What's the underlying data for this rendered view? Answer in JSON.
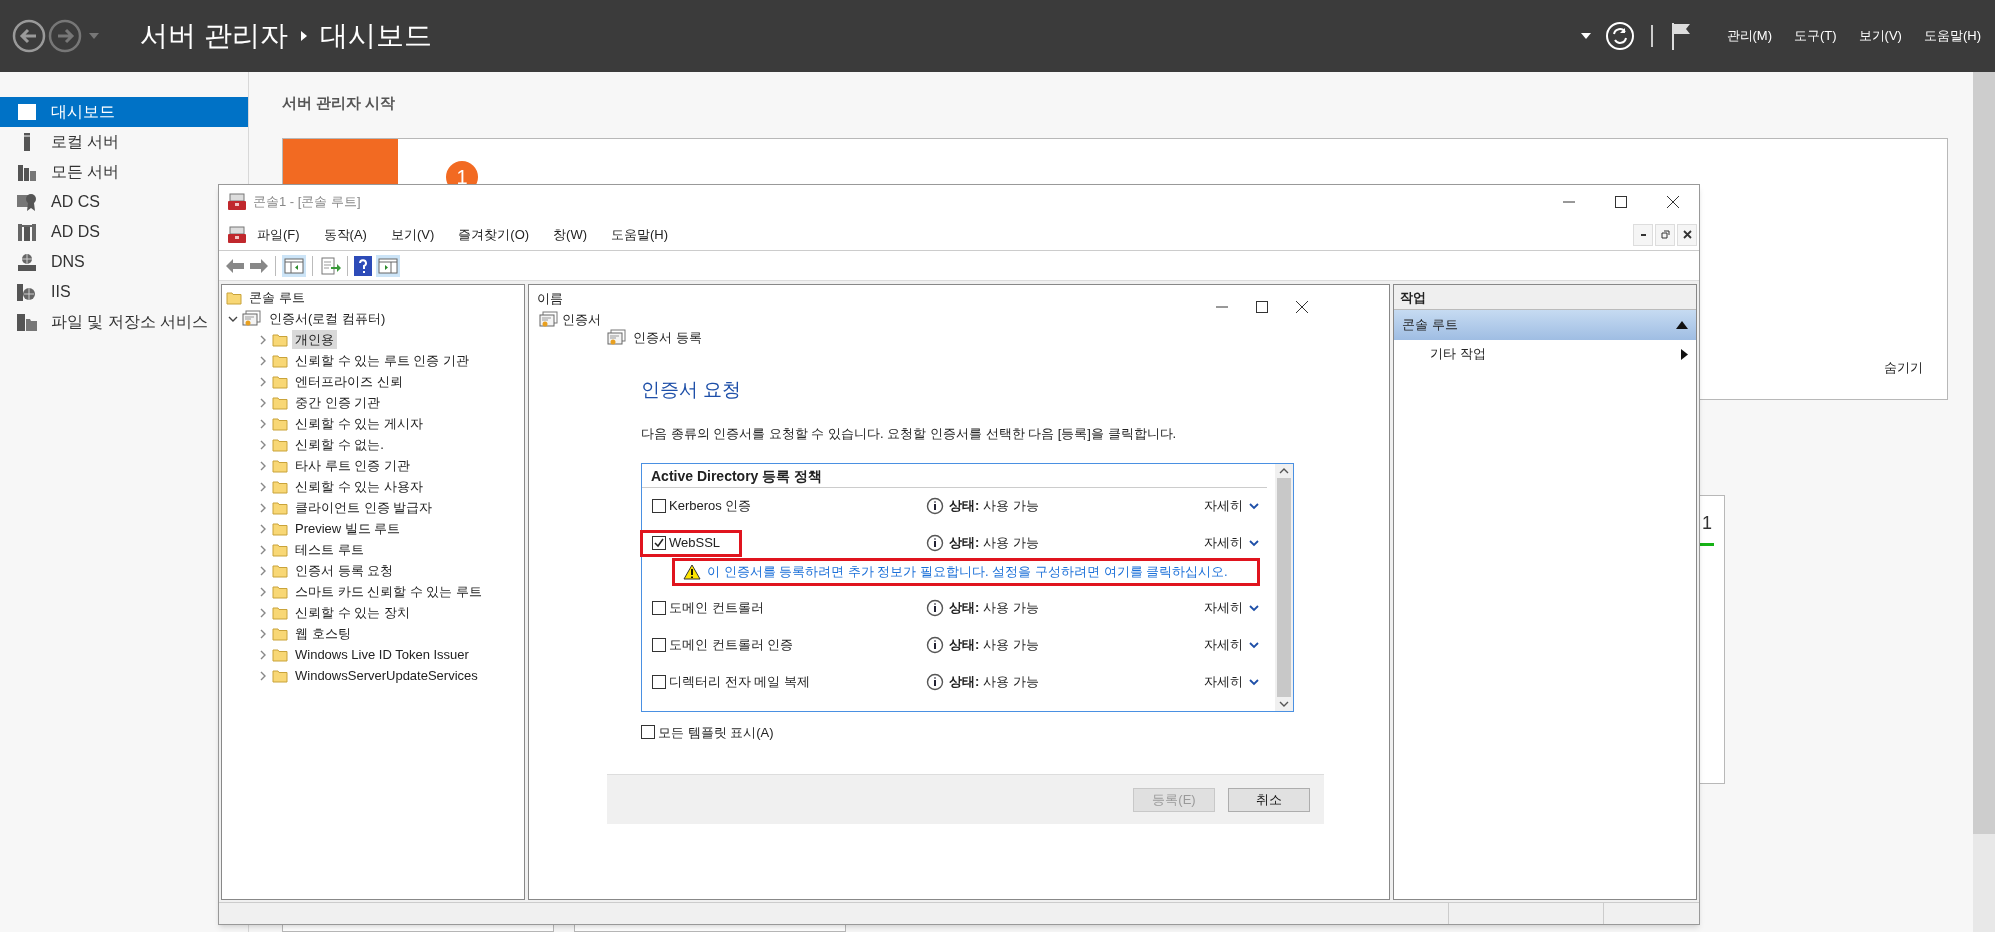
{
  "top_bar": {
    "breadcrumb": [
      "서버 관리자",
      "대시보드"
    ],
    "menu": [
      "관리(M)",
      "도구(T)",
      "보기(V)",
      "도움말(H)"
    ]
  },
  "sidebar": {
    "items": [
      {
        "label": "대시보드",
        "selected": true
      },
      {
        "label": "로컬 서버",
        "selected": false
      },
      {
        "label": "모든 서버",
        "selected": false
      },
      {
        "label": "AD CS",
        "selected": false
      },
      {
        "label": "AD DS",
        "selected": false
      },
      {
        "label": "DNS",
        "selected": false
      },
      {
        "label": "IIS",
        "selected": false
      },
      {
        "label": "파일 및 저장소 서비스",
        "selected": false
      }
    ]
  },
  "dashboard": {
    "heading": "서버 관리자 시작",
    "quick_start": {
      "step": "1",
      "hide": "숨기기"
    },
    "tile": {
      "count": "1"
    }
  },
  "console": {
    "title": "콘솔1 - [콘솔 루트]",
    "menu": [
      "파일(F)",
      "동작(A)",
      "보기(V)",
      "즐겨찾기(O)",
      "창(W)",
      "도움말(H)"
    ],
    "tree": {
      "label": "콘솔 루트",
      "children": [
        {
          "label": "인증서(로컬 컴퓨터)",
          "expanded": true,
          "selected": false,
          "children": [
            {
              "label": "개인용",
              "expanded": false,
              "selected": true
            },
            {
              "label": "신뢰할 수 있는 루트 인증 기관",
              "expanded": false,
              "selected": false
            },
            {
              "label": "엔터프라이즈 신뢰",
              "expanded": false,
              "selected": false
            },
            {
              "label": "중간 인증 기관",
              "expanded": false,
              "selected": false
            },
            {
              "label": "신뢰할 수 있는 게시자",
              "expanded": false,
              "selected": false
            },
            {
              "label": "신뢰할 수 없는.",
              "expanded": false,
              "selected": false
            },
            {
              "label": "타사 루트 인증 기관",
              "expanded": false,
              "selected": false
            },
            {
              "label": "신뢰할 수 있는 사용자",
              "expanded": false,
              "selected": false
            },
            {
              "label": "클라이언트 인증 발급자",
              "expanded": false,
              "selected": false
            },
            {
              "label": "Preview 빌드 루트",
              "expanded": false,
              "selected": false
            },
            {
              "label": "테스트 루트",
              "expanded": false,
              "selected": false
            },
            {
              "label": "인증서 등록 요청",
              "expanded": false,
              "selected": false
            },
            {
              "label": "스마트 카드 신뢰할 수 있는 루트",
              "expanded": false,
              "selected": false
            },
            {
              "label": "신뢰할 수 있는 장치",
              "expanded": false,
              "selected": false
            },
            {
              "label": "웹 호스팅",
              "expanded": false,
              "selected": false
            },
            {
              "label": "Windows Live ID Token Issuer",
              "expanded": false,
              "selected": false
            },
            {
              "label": "WindowsServerUpdateServices",
              "expanded": false,
              "selected": false
            }
          ]
        }
      ]
    },
    "list": {
      "column": "이름",
      "items": [
        "인증서"
      ]
    },
    "actions": {
      "header": "작업",
      "section": "콘솔 루트",
      "items": [
        "기타 작업"
      ]
    }
  },
  "enrollment": {
    "title": "인증서 등록",
    "heading": "인증서 요청",
    "description": "다음 종류의 인증서를 요청할 수 있습니다. 요청할 인증서를 선택한 다음 [등록]을 클릭합니다.",
    "policy": "Active Directory 등록 정책",
    "templates": [
      {
        "name": "Kerberos 인증",
        "checked": false,
        "highlighted": false,
        "status": "**상태:** 사용 가능",
        "details": "자세히"
      },
      {
        "name": "WebSSL",
        "checked": true,
        "highlighted": true,
        "status": "**상태:** 사용 가능",
        "details": "자세히",
        "warning": "이 인증서를 등록하려면 추가 정보가 필요합니다. 설정을 구성하려면 여기를 클릭하십시오."
      },
      {
        "name": "도메인 컨트롤러",
        "checked": false,
        "highlighted": false,
        "status": "**상태:** 사용 가능",
        "details": "자세히"
      },
      {
        "name": "도메인 컨트롤러 인증",
        "checked": false,
        "highlighted": false,
        "status": "**상태:** 사용 가능",
        "details": "자세히"
      },
      {
        "name": "디렉터리 전자 메일 복제",
        "checked": false,
        "highlighted": false,
        "status": "**상태:** 사용 가능",
        "details": "자세히"
      }
    ],
    "show_all": {
      "label": "모든 템플릿 표시(A)",
      "checked": false
    },
    "buttons": [
      {
        "label": "등록(E)",
        "disabled": true
      },
      {
        "label": "취소",
        "disabled": false
      }
    ]
  }
}
